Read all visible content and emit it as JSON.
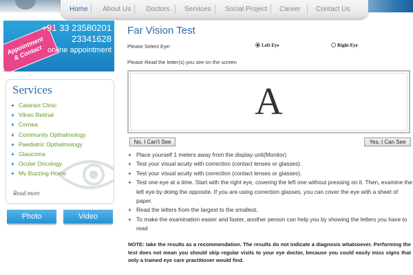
{
  "nav": {
    "items": [
      "Home",
      "About Us",
      "Doctors",
      "Services",
      "Social Project",
      "Career",
      "Contact Us"
    ],
    "active": "Home"
  },
  "appointment": {
    "tag_line1": "Appointment",
    "tag_line2": "& Contact",
    "phone1": "+91 33 23580201",
    "phone2": "23341628",
    "online": "online appointment"
  },
  "sidebar": {
    "title": "Services",
    "items": [
      "Cataract Clinic",
      "Vitreo Retinal",
      "Cornea",
      "Community Opthalmology",
      "Paediatric Opthalmology",
      "Glaucoma",
      "Ocular Oncology",
      "My Buzzing Home"
    ],
    "read_more": "Read more"
  },
  "media": {
    "photo": "Photo",
    "video": "Video"
  },
  "main": {
    "title": "Far Vision Test",
    "select_eye_label": "Please Select Eye:",
    "left_eye": "Left Eye",
    "right_eye": "Right Eye",
    "selected_eye": "Left Eye",
    "read_instruction": "Please Read the letter(s) you see on the screen",
    "test_letter": "A",
    "no_button": "No, I Can't See",
    "yes_button": "Yes, I Can See",
    "instructions": [
      "Place yourself 1 meters away from the display unit(Monitor)",
      "Test your visual acuity with correction (contact lenses or glasses).",
      "Test your visual acuity with correction (contact lenses or glasses).",
      "Test one eye at a time. Start with the right eye, covering the left one without pressing on it. Then, examine the left eye by doing the opposite. If you are using correction glasses, you can cover the eye with a sheet of paper.",
      "Read the letters from the largest to the smallest.",
      "To make the examination easier and faster, another person can help you by showing the letters you have to read"
    ],
    "note": "NOTE: take the results as a recommendation. The results do not indicate a diagnosis whatsoever. Performing the test does not mean you should skip regular visits to your eye doctor, because you could easily miss signs that only a trained eye care practitioner would find."
  },
  "colors": {
    "accent": "#2c6aa4",
    "service_link": "#5a9a1e",
    "banner_blue": "#1a7fc0",
    "tag_pink": "#e9458b"
  }
}
